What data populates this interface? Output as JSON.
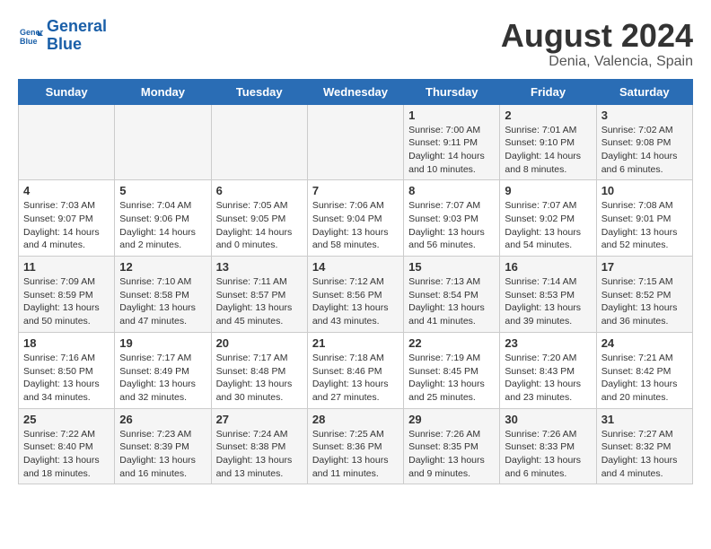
{
  "logo": {
    "line1": "General",
    "line2": "Blue"
  },
  "title": "August 2024",
  "subtitle": "Denia, Valencia, Spain",
  "days_of_week": [
    "Sunday",
    "Monday",
    "Tuesday",
    "Wednesday",
    "Thursday",
    "Friday",
    "Saturday"
  ],
  "weeks": [
    [
      {
        "day": "",
        "info": ""
      },
      {
        "day": "",
        "info": ""
      },
      {
        "day": "",
        "info": ""
      },
      {
        "day": "",
        "info": ""
      },
      {
        "day": "1",
        "info": "Sunrise: 7:00 AM\nSunset: 9:11 PM\nDaylight: 14 hours\nand 10 minutes."
      },
      {
        "day": "2",
        "info": "Sunrise: 7:01 AM\nSunset: 9:10 PM\nDaylight: 14 hours\nand 8 minutes."
      },
      {
        "day": "3",
        "info": "Sunrise: 7:02 AM\nSunset: 9:08 PM\nDaylight: 14 hours\nand 6 minutes."
      }
    ],
    [
      {
        "day": "4",
        "info": "Sunrise: 7:03 AM\nSunset: 9:07 PM\nDaylight: 14 hours\nand 4 minutes."
      },
      {
        "day": "5",
        "info": "Sunrise: 7:04 AM\nSunset: 9:06 PM\nDaylight: 14 hours\nand 2 minutes."
      },
      {
        "day": "6",
        "info": "Sunrise: 7:05 AM\nSunset: 9:05 PM\nDaylight: 14 hours\nand 0 minutes."
      },
      {
        "day": "7",
        "info": "Sunrise: 7:06 AM\nSunset: 9:04 PM\nDaylight: 13 hours\nand 58 minutes."
      },
      {
        "day": "8",
        "info": "Sunrise: 7:07 AM\nSunset: 9:03 PM\nDaylight: 13 hours\nand 56 minutes."
      },
      {
        "day": "9",
        "info": "Sunrise: 7:07 AM\nSunset: 9:02 PM\nDaylight: 13 hours\nand 54 minutes."
      },
      {
        "day": "10",
        "info": "Sunrise: 7:08 AM\nSunset: 9:01 PM\nDaylight: 13 hours\nand 52 minutes."
      }
    ],
    [
      {
        "day": "11",
        "info": "Sunrise: 7:09 AM\nSunset: 8:59 PM\nDaylight: 13 hours\nand 50 minutes."
      },
      {
        "day": "12",
        "info": "Sunrise: 7:10 AM\nSunset: 8:58 PM\nDaylight: 13 hours\nand 47 minutes."
      },
      {
        "day": "13",
        "info": "Sunrise: 7:11 AM\nSunset: 8:57 PM\nDaylight: 13 hours\nand 45 minutes."
      },
      {
        "day": "14",
        "info": "Sunrise: 7:12 AM\nSunset: 8:56 PM\nDaylight: 13 hours\nand 43 minutes."
      },
      {
        "day": "15",
        "info": "Sunrise: 7:13 AM\nSunset: 8:54 PM\nDaylight: 13 hours\nand 41 minutes."
      },
      {
        "day": "16",
        "info": "Sunrise: 7:14 AM\nSunset: 8:53 PM\nDaylight: 13 hours\nand 39 minutes."
      },
      {
        "day": "17",
        "info": "Sunrise: 7:15 AM\nSunset: 8:52 PM\nDaylight: 13 hours\nand 36 minutes."
      }
    ],
    [
      {
        "day": "18",
        "info": "Sunrise: 7:16 AM\nSunset: 8:50 PM\nDaylight: 13 hours\nand 34 minutes."
      },
      {
        "day": "19",
        "info": "Sunrise: 7:17 AM\nSunset: 8:49 PM\nDaylight: 13 hours\nand 32 minutes."
      },
      {
        "day": "20",
        "info": "Sunrise: 7:17 AM\nSunset: 8:48 PM\nDaylight: 13 hours\nand 30 minutes."
      },
      {
        "day": "21",
        "info": "Sunrise: 7:18 AM\nSunset: 8:46 PM\nDaylight: 13 hours\nand 27 minutes."
      },
      {
        "day": "22",
        "info": "Sunrise: 7:19 AM\nSunset: 8:45 PM\nDaylight: 13 hours\nand 25 minutes."
      },
      {
        "day": "23",
        "info": "Sunrise: 7:20 AM\nSunset: 8:43 PM\nDaylight: 13 hours\nand 23 minutes."
      },
      {
        "day": "24",
        "info": "Sunrise: 7:21 AM\nSunset: 8:42 PM\nDaylight: 13 hours\nand 20 minutes."
      }
    ],
    [
      {
        "day": "25",
        "info": "Sunrise: 7:22 AM\nSunset: 8:40 PM\nDaylight: 13 hours\nand 18 minutes."
      },
      {
        "day": "26",
        "info": "Sunrise: 7:23 AM\nSunset: 8:39 PM\nDaylight: 13 hours\nand 16 minutes."
      },
      {
        "day": "27",
        "info": "Sunrise: 7:24 AM\nSunset: 8:38 PM\nDaylight: 13 hours\nand 13 minutes."
      },
      {
        "day": "28",
        "info": "Sunrise: 7:25 AM\nSunset: 8:36 PM\nDaylight: 13 hours\nand 11 minutes."
      },
      {
        "day": "29",
        "info": "Sunrise: 7:26 AM\nSunset: 8:35 PM\nDaylight: 13 hours\nand 9 minutes."
      },
      {
        "day": "30",
        "info": "Sunrise: 7:26 AM\nSunset: 8:33 PM\nDaylight: 13 hours\nand 6 minutes."
      },
      {
        "day": "31",
        "info": "Sunrise: 7:27 AM\nSunset: 8:32 PM\nDaylight: 13 hours\nand 4 minutes."
      }
    ]
  ]
}
